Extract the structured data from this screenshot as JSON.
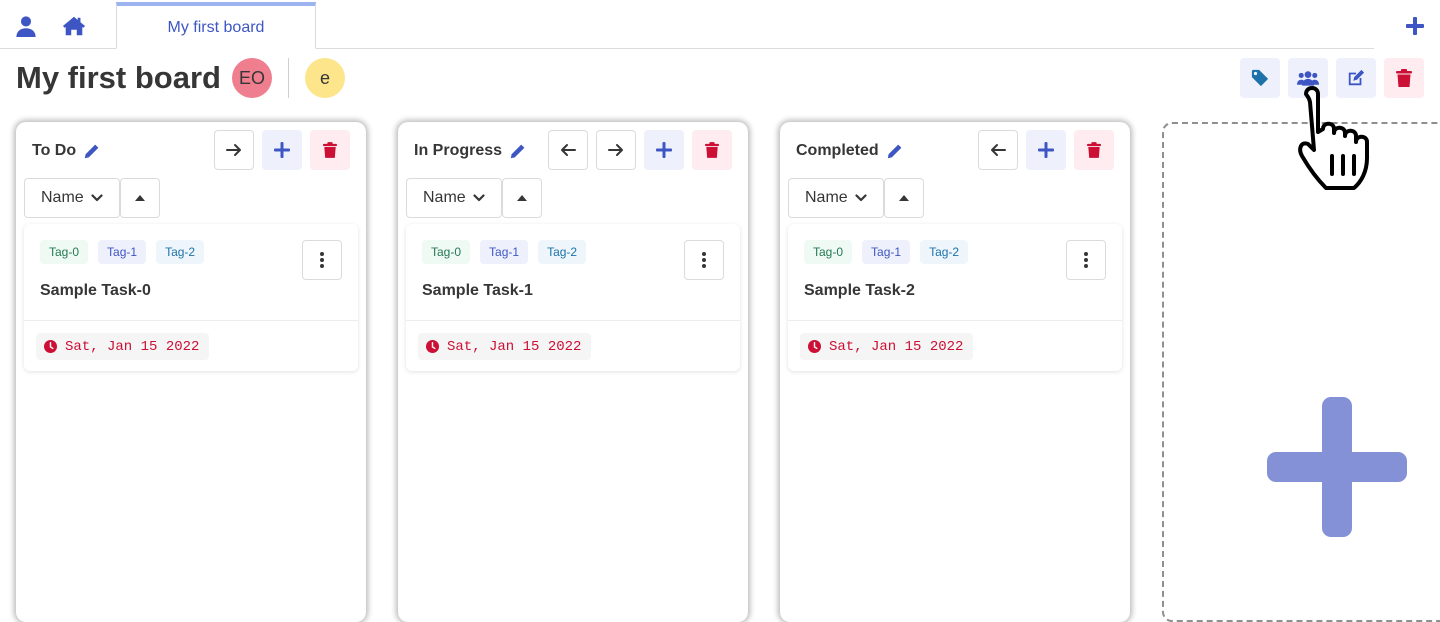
{
  "nav": {
    "user_icon": "user-icon",
    "home_icon": "home-icon",
    "add_board_icon": "plus-icon",
    "tabs": [
      {
        "label": "My first board",
        "active": true
      }
    ]
  },
  "header": {
    "title": "My first board",
    "members": [
      {
        "initials": "EO",
        "color": "#ef7f8e"
      },
      {
        "initials": "e",
        "color": "#fde58c"
      }
    ],
    "actions": [
      "tag-icon",
      "users-icon",
      "edit-icon",
      "trash-icon"
    ]
  },
  "columns": [
    {
      "title": "To Do",
      "sort": {
        "field": "Name"
      },
      "cards": [
        {
          "tags": [
            "Tag-0",
            "Tag-1",
            "Tag-2"
          ],
          "name": "Sample Task-0",
          "due": "Sat, Jan 15 2022"
        }
      ]
    },
    {
      "title": "In Progress",
      "sort": {
        "field": "Name"
      },
      "cards": [
        {
          "tags": [
            "Tag-0",
            "Tag-1",
            "Tag-2"
          ],
          "name": "Sample Task-1",
          "due": "Sat, Jan 15 2022"
        }
      ]
    },
    {
      "title": "Completed",
      "sort": {
        "field": "Name"
      },
      "cards": [
        {
          "tags": [
            "Tag-0",
            "Tag-1",
            "Tag-2"
          ],
          "name": "Sample Task-2",
          "due": "Sat, Jan 15 2022"
        }
      ]
    }
  ],
  "colors": {
    "accent": "#3e56c4",
    "danger": "#cc0f35",
    "add_column_plus": "#8591d7"
  }
}
